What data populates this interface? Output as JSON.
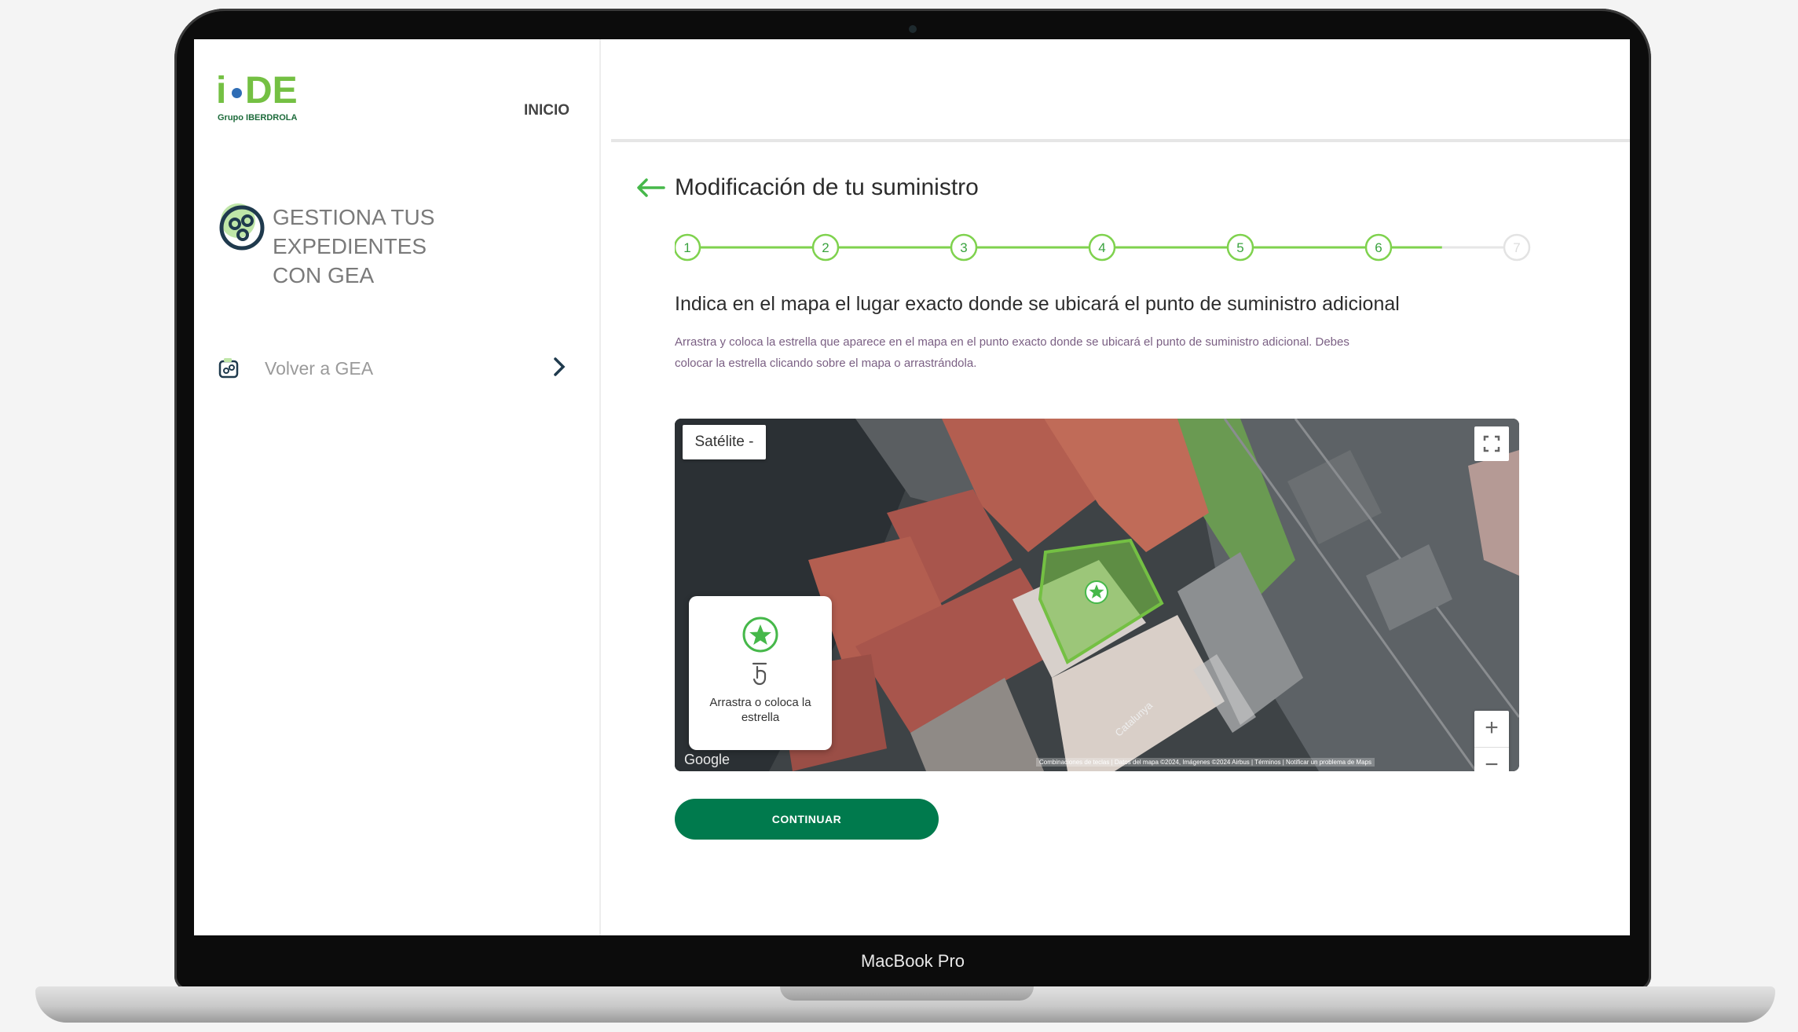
{
  "device": {
    "label": "MacBook Pro"
  },
  "logo": {
    "mark_i": "i",
    "mark_de": "DE",
    "group": "Grupo IBERDROLA"
  },
  "nav": {
    "home": "INICIO"
  },
  "sidebar": {
    "gea_title_line1": "GESTIONA TUS EXPEDIENTES",
    "gea_title_line2": "CON GEA",
    "back_link": "Volver a GEA"
  },
  "main": {
    "title": "Modificación de tu suministro",
    "steps": [
      "1",
      "2",
      "3",
      "4",
      "5",
      "6",
      "7"
    ],
    "current_step": 6,
    "question": "Indica en el mapa el lugar exacto donde se ubicará el punto de suministro adicional",
    "help_line1": "Arrastra y coloca la estrella que aparece en el mapa en el punto exacto donde se ubicará el punto de suministro adicional. Debes",
    "help_line2": "colocar la estrella clicando sobre el mapa o arrastrándola.",
    "continue_label": "CONTINUAR"
  },
  "map": {
    "type_label": "Satélite -",
    "zoom_in": "+",
    "zoom_out": "−",
    "card_text": "Arrastra o coloca la estrella",
    "provider": "Google",
    "attribution": "Combinaciones de teclas | Datos del mapa ©2024, Imágenes ©2024 Airbus | Términos | Notificar un problema de Maps",
    "street": "Catalunya"
  },
  "colors": {
    "brand_green": "#74c043",
    "button_green": "#007a4d",
    "step_green": "#7fd24e"
  },
  "icons": [
    "gea-icon",
    "gea-back-icon",
    "chevron-right-icon",
    "back-arrow-icon",
    "fullscreen-icon",
    "star-icon",
    "hand-pointer-icon",
    "location-star-icon"
  ]
}
